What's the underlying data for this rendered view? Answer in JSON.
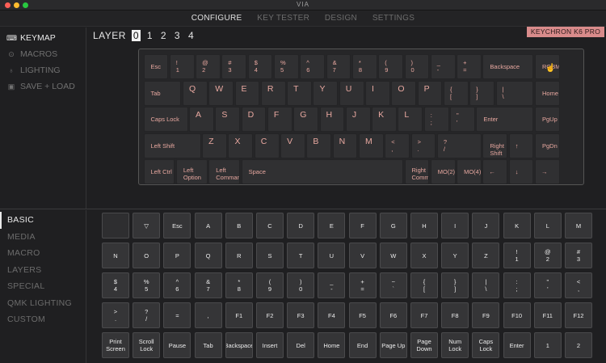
{
  "window": {
    "title": "VIA"
  },
  "nav": {
    "tabs": [
      {
        "label": "CONFIGURE",
        "active": true
      },
      {
        "label": "KEY TESTER",
        "active": false
      },
      {
        "label": "DESIGN",
        "active": false
      },
      {
        "label": "SETTINGS",
        "active": false
      }
    ]
  },
  "sidebar": {
    "items": [
      {
        "label": "KEYMAP",
        "icon": "keyboard-icon",
        "active": true
      },
      {
        "label": "MACROS",
        "icon": "macro-circle-icon",
        "active": false
      },
      {
        "label": "LIGHTING",
        "icon": "bulb-icon",
        "active": false
      },
      {
        "label": "SAVE + LOAD",
        "icon": "floppy-icon",
        "active": false
      }
    ]
  },
  "layers": {
    "label": "LAYER",
    "values": [
      "0",
      "1",
      "2",
      "3",
      "4"
    ],
    "selected": "0"
  },
  "keyboard": {
    "name": "KEYCHRON K6 PRO",
    "rows": [
      [
        [
          "Esc"
        ],
        [
          "!",
          "1"
        ],
        [
          "@",
          "2"
        ],
        [
          "#",
          "3"
        ],
        [
          "$",
          "4"
        ],
        [
          "%",
          "5"
        ],
        [
          "^",
          "6"
        ],
        [
          "&",
          "7"
        ],
        [
          "*",
          "8"
        ],
        [
          "(",
          "9"
        ],
        [
          ")",
          "0"
        ],
        [
          "_",
          "-"
        ],
        [
          "+",
          "="
        ],
        [
          "Backspace"
        ],
        [
          "RGBMd+"
        ]
      ],
      [
        [
          "Tab"
        ],
        [
          "Q"
        ],
        [
          "W"
        ],
        [
          "E"
        ],
        [
          "R"
        ],
        [
          "T"
        ],
        [
          "Y"
        ],
        [
          "U"
        ],
        [
          "I"
        ],
        [
          "O"
        ],
        [
          "P"
        ],
        [
          "{",
          "["
        ],
        [
          "}",
          "]"
        ],
        [
          "|",
          "\\"
        ],
        [
          "Home"
        ]
      ],
      [
        [
          "Caps Lock"
        ],
        [
          "A"
        ],
        [
          "S"
        ],
        [
          "D"
        ],
        [
          "F"
        ],
        [
          "G"
        ],
        [
          "H"
        ],
        [
          "J"
        ],
        [
          "K"
        ],
        [
          "L"
        ],
        [
          ":",
          ";"
        ],
        [
          "\"",
          "'"
        ],
        [
          "Enter"
        ],
        [
          "PgUp"
        ]
      ],
      [
        [
          "Left Shift"
        ],
        [
          "Z"
        ],
        [
          "X"
        ],
        [
          "C"
        ],
        [
          "V"
        ],
        [
          "B"
        ],
        [
          "N"
        ],
        [
          "M"
        ],
        [
          "<",
          ","
        ],
        [
          ">",
          "."
        ],
        [
          "?",
          "/"
        ],
        [
          "Right Shift"
        ],
        [
          "↑"
        ],
        [
          "PgDn"
        ]
      ],
      [
        [
          "Left Ctrl"
        ],
        [
          "Left",
          "Option"
        ],
        [
          "Left",
          "Command"
        ],
        [
          "Space"
        ],
        [
          "Right",
          "Comma"
        ],
        [
          "MO(2)"
        ],
        [
          "MO(4)"
        ],
        [
          "←"
        ],
        [
          "↓"
        ],
        [
          "→"
        ]
      ]
    ]
  },
  "categories": [
    {
      "label": "BASIC",
      "active": true
    },
    {
      "label": "MEDIA",
      "active": false
    },
    {
      "label": "MACRO",
      "active": false
    },
    {
      "label": "LAYERS",
      "active": false
    },
    {
      "label": "SPECIAL",
      "active": false
    },
    {
      "label": "QMK LIGHTING",
      "active": false
    },
    {
      "label": "CUSTOM",
      "active": false
    }
  ],
  "palette": [
    [
      [
        ""
      ],
      [
        "▽"
      ],
      [
        "Esc"
      ],
      [
        "A"
      ],
      [
        "B"
      ],
      [
        "C"
      ],
      [
        "D"
      ],
      [
        "E"
      ],
      [
        "F"
      ],
      [
        "G"
      ],
      [
        "H"
      ],
      [
        "I"
      ],
      [
        "J"
      ],
      [
        "K"
      ],
      [
        "L"
      ],
      [
        "M"
      ]
    ],
    [
      [
        "N"
      ],
      [
        "O"
      ],
      [
        "P"
      ],
      [
        "Q"
      ],
      [
        "R"
      ],
      [
        "S"
      ],
      [
        "T"
      ],
      [
        "U"
      ],
      [
        "V"
      ],
      [
        "W"
      ],
      [
        "X"
      ],
      [
        "Y"
      ],
      [
        "Z"
      ],
      [
        "!",
        "1"
      ],
      [
        "@",
        "2"
      ],
      [
        "#",
        "3"
      ]
    ],
    [
      [
        "$",
        "4"
      ],
      [
        "%",
        "5"
      ],
      [
        "^",
        "6"
      ],
      [
        "&",
        "7"
      ],
      [
        "*",
        "8"
      ],
      [
        "(",
        "9"
      ],
      [
        ")",
        "0"
      ],
      [
        "_",
        "-"
      ],
      [
        "+",
        "="
      ],
      [
        "~",
        "`"
      ],
      [
        "{",
        "["
      ],
      [
        "}",
        "]"
      ],
      [
        "|",
        "\\"
      ],
      [
        ":",
        ";"
      ],
      [
        "\"",
        "'"
      ],
      [
        "<",
        ","
      ]
    ],
    [
      [
        ">",
        "."
      ],
      [
        "?",
        "/"
      ],
      [
        "="
      ],
      [
        ","
      ],
      [
        "F1"
      ],
      [
        "F2"
      ],
      [
        "F3"
      ],
      [
        "F4"
      ],
      [
        "F5"
      ],
      [
        "F6"
      ],
      [
        "F7"
      ],
      [
        "F8"
      ],
      [
        "F9"
      ],
      [
        "F10"
      ],
      [
        "F11"
      ],
      [
        "F12"
      ]
    ],
    [
      [
        "Print",
        "Screen"
      ],
      [
        "Scroll",
        "Lock"
      ],
      [
        "Pause"
      ],
      [
        "Tab"
      ],
      [
        "Backspace"
      ],
      [
        "Insert"
      ],
      [
        "Del"
      ],
      [
        "Home"
      ],
      [
        "End"
      ],
      [
        "Page Up"
      ],
      [
        "Page",
        "Down"
      ],
      [
        "Num",
        "Lock"
      ],
      [
        "Caps",
        "Lock"
      ],
      [
        "Enter"
      ],
      [
        "1"
      ],
      [
        "2"
      ]
    ]
  ],
  "colors": {
    "legend": "#e8a8a0",
    "badge": "#d98b8b",
    "close": "#fe5f57",
    "minimize": "#febc2e",
    "maximize": "#28c840"
  }
}
